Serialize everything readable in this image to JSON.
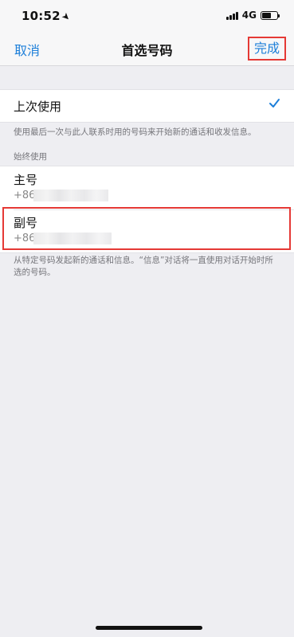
{
  "status_bar": {
    "time": "10:52",
    "location_icon": "location-arrow-icon",
    "network": "4G",
    "signal_icon": "signal-bars-icon",
    "battery_icon": "battery-icon",
    "battery_level_percent": 55
  },
  "nav": {
    "cancel_label": "取消",
    "title": "首选号码",
    "done_label": "完成"
  },
  "last_used": {
    "label": "上次使用",
    "selected": true,
    "check_icon": "checkmark-icon",
    "footnote": "使用最后一次与此人联系时用的号码来开始新的通话和收发信息。"
  },
  "always_use": {
    "section_label": "始终使用",
    "lines": [
      {
        "name": "主号",
        "number_prefix": "+86"
      },
      {
        "name": "副号",
        "number_prefix": "+86"
      }
    ],
    "footnote": "从特定号码发起新的通话和信息。“信息”对话将一直使用对话开始时所选的号码。"
  },
  "colors": {
    "accent": "#1d7fd9",
    "highlight_outline": "#e53935",
    "background": "#eeeef2"
  }
}
